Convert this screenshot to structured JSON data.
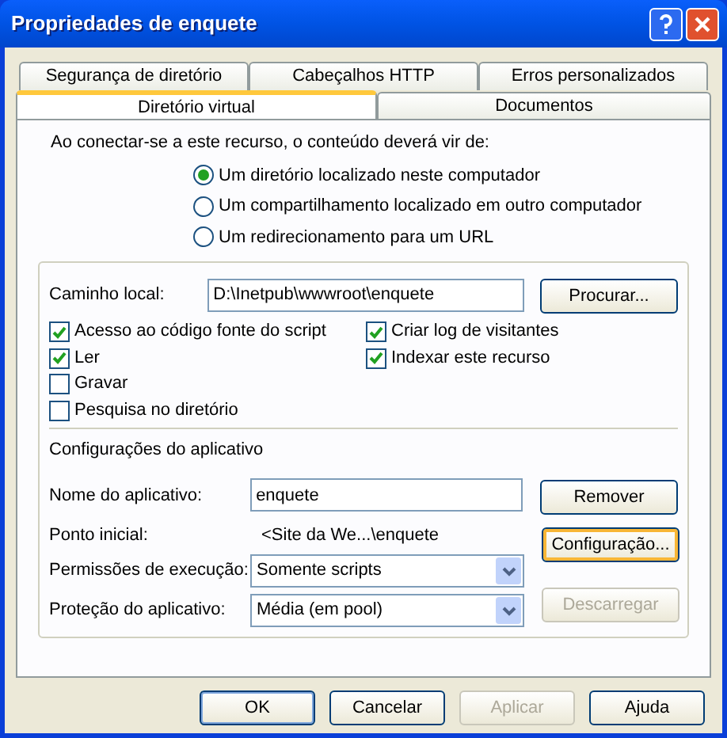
{
  "window": {
    "title": "Propriedades de enquete"
  },
  "tab_rows": [
    [
      {
        "label": "Segurança de diretório",
        "selected": false
      },
      {
        "label": "Cabeçalhos HTTP",
        "selected": false
      },
      {
        "label": "Erros personalizados",
        "selected": false
      }
    ],
    [
      {
        "label": "Diretório virtual",
        "selected": true
      },
      {
        "label": "Documentos",
        "selected": false
      }
    ]
  ],
  "source": {
    "prompt": "Ao conectar-se a este recurso, o conteúdo deverá vir de:",
    "options": [
      {
        "label": "Um diretório localizado neste computador",
        "selected": true
      },
      {
        "label": "Um compartilhamento localizado em outro computador",
        "selected": false
      },
      {
        "label": "Um redirecionamento para um URL",
        "selected": false
      }
    ]
  },
  "local_path": {
    "label": "Caminho local:",
    "value": "D:\\Inetpub\\wwwroot\\enquete",
    "button": "Procurar..."
  },
  "permission_columns": [
    [
      {
        "label": "Acesso ao código fonte do script",
        "checked": true
      },
      {
        "label": "Ler",
        "checked": true
      },
      {
        "label": "Gravar",
        "checked": false
      },
      {
        "label": "Pesquisa no diretório",
        "checked": false
      }
    ],
    [
      {
        "label": "Criar log de visitantes",
        "checked": true
      },
      {
        "label": "Indexar este recurso",
        "checked": true
      }
    ]
  ],
  "app_settings": {
    "heading": "Configurações do aplicativo",
    "name": {
      "label": "Nome do aplicativo:",
      "value": "enquete",
      "button": "Remover"
    },
    "start": {
      "label": "Ponto inicial:",
      "value": "<Site da We...\\enquete"
    },
    "config_button": {
      "label": "Configuração...",
      "focused": true
    },
    "execute": {
      "label": "Permissões de execução:",
      "value": "Somente scripts"
    },
    "protection": {
      "label": "Proteção do aplicativo:",
      "value": "Média (em pool)"
    },
    "unload_button": {
      "label": "Descarregar",
      "disabled": true
    }
  },
  "buttons": [
    {
      "label": "OK",
      "disabled": false,
      "default": true
    },
    {
      "label": "Cancelar",
      "disabled": false,
      "default": false
    },
    {
      "label": "Aplicar",
      "disabled": true,
      "default": false
    },
    {
      "label": "Ajuda",
      "disabled": false,
      "default": false
    }
  ]
}
